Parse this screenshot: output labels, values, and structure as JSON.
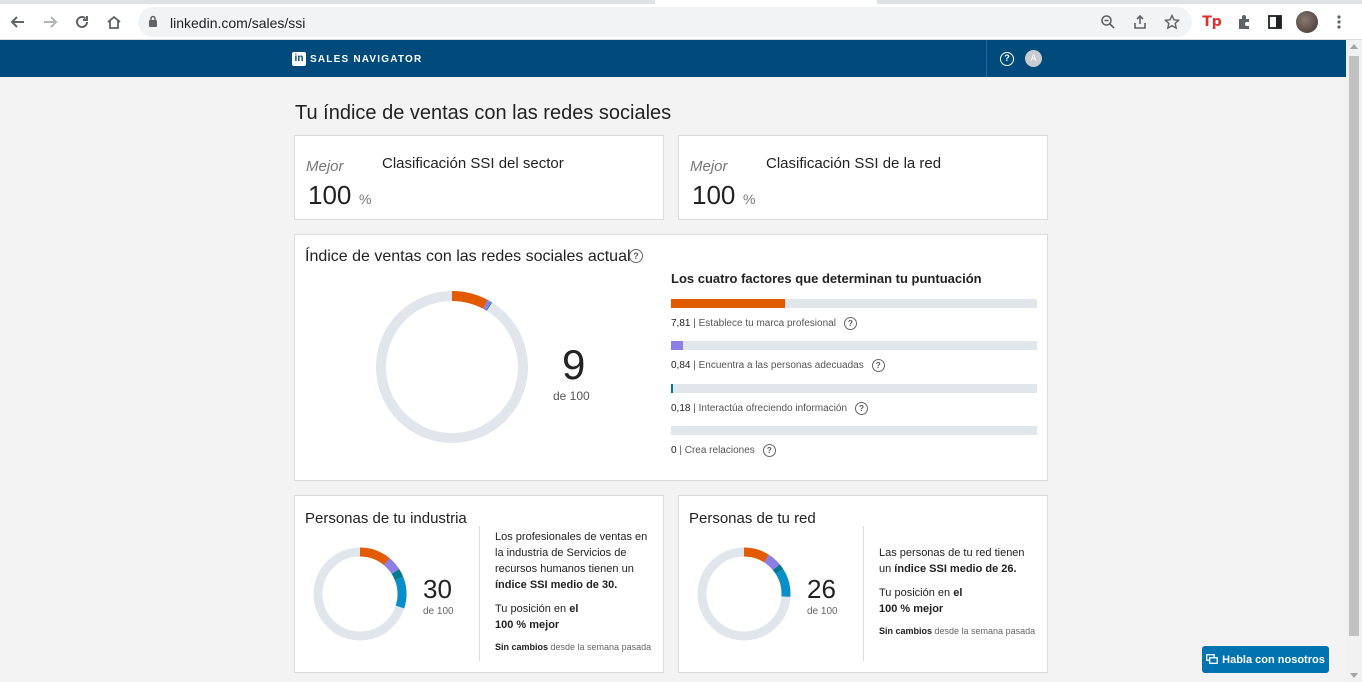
{
  "browser": {
    "url": "linkedin.com/sales/ssi"
  },
  "header": {
    "logo": "in",
    "brand": "SALES NAVIGATOR",
    "help": "?",
    "avatar_initial": "A"
  },
  "page": {
    "title": "Tu índice de ventas con las redes sociales"
  },
  "rank_cards": [
    {
      "best_label": "Mejor",
      "title": "Clasificación SSI del sector",
      "value": "100",
      "unit": "%"
    },
    {
      "best_label": "Mejor",
      "title": "Clasificación SSI de la red",
      "value": "100",
      "unit": "%"
    }
  ],
  "current": {
    "title": "Índice de ventas con las redes sociales actual",
    "score": "9",
    "of_label": "de 100",
    "factors_title": "Los cuatro factores que determinan tu puntuación",
    "factors": [
      {
        "value": "7,81",
        "label": "Establece tu marca profesional",
        "fraction": 0.3124,
        "color": "#e35b00"
      },
      {
        "value": "0,84",
        "label": "Encuentra a las personas adecuadas",
        "fraction": 0.0336,
        "color": "#8c7ee3"
      },
      {
        "value": "0,18",
        "label": "Interactúa ofreciendo información",
        "fraction": 0.0072,
        "color": "#007a8a"
      },
      {
        "value": "0",
        "label": "Crea relaciones",
        "fraction": 0.0,
        "color": "#0a8ec9"
      }
    ]
  },
  "peers": [
    {
      "title": "Personas de tu industria",
      "score": "30",
      "of_label": "de 100",
      "desc_plain": "Los profesionales de ventas en la industria de Servicios de recursos humanos tienen un ",
      "desc_bold": "índice SSI medio de 30.",
      "position_plain": "Tu posición en ",
      "position_bold1": "el",
      "position_bold2": "100 % mejor",
      "nochange_bold": "Sin cambios",
      "nochange_rest": " desde la semana pasada",
      "segments": [
        11,
        5,
        3,
        11
      ]
    },
    {
      "title": "Personas de tu red",
      "score": "26",
      "of_label": "de 100",
      "desc_plain": "Las personas de tu red tienen un ",
      "desc_bold": "índice SSI medio de 26.",
      "position_plain": "Tu posición en ",
      "position_bold1": "el",
      "position_bold2": "100 % mejor",
      "nochange_bold": "Sin cambios",
      "nochange_rest": " desde la semana pasada",
      "segments": [
        9,
        5,
        2,
        10
      ]
    }
  ],
  "chat_button": "Habla con nosotros",
  "colors": {
    "brand_blue": "#004b7c",
    "orange": "#e35b00",
    "purple": "#8c7ee3",
    "teal": "#007a8a",
    "blue": "#0a8ec9",
    "track": "#e1e6ec"
  }
}
